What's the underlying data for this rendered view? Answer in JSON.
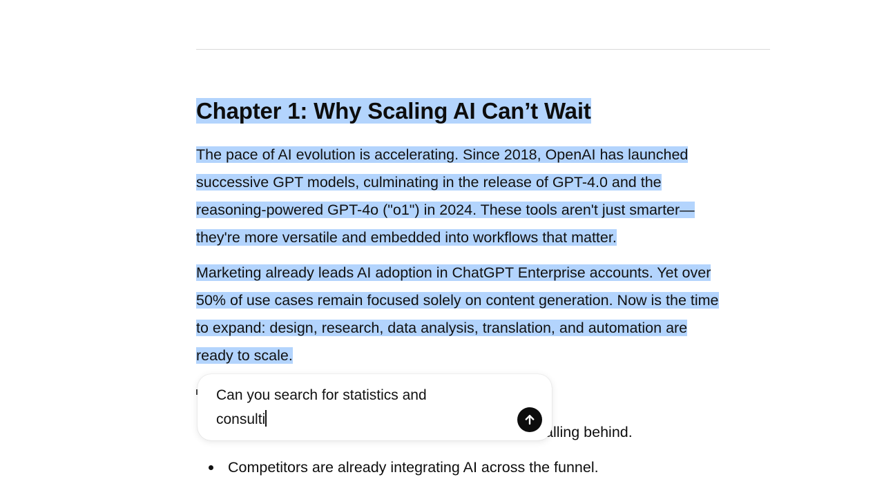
{
  "document": {
    "heading": "Chapter 1: Why Scaling AI Can’t Wait",
    "paragraph1_lines": [
      "The pace of AI evolution is accelerating. Since 2018, OpenAI has launched",
      "successive GPT models, culminating in the release of GPT-4.0 and the",
      "reasoning-powered GPT-4o (\"o1\") in 2024. These tools aren't just smarter—",
      "they're more versatile and embedded into workflows that matter."
    ],
    "paragraph2_lines": [
      "Marketing already leads AI adoption in ChatGPT Enterprise accounts. Yet over",
      "50% of use cases remain focused solely on content generation. Now is the time",
      "to expand: design, research, data analysis, translation, and automation are",
      "ready to scale."
    ],
    "bullets": [
      "alling behind.",
      "Competitors are already integrating AI across the funnel."
    ]
  },
  "prompt_popup": {
    "input_value_line1": "Can you search for statistics and",
    "input_value_line2": "consulti",
    "send_icon": "arrow-up-icon"
  },
  "colors": {
    "selection": "#b3d4fd",
    "send_button": "#0d0d0d"
  }
}
